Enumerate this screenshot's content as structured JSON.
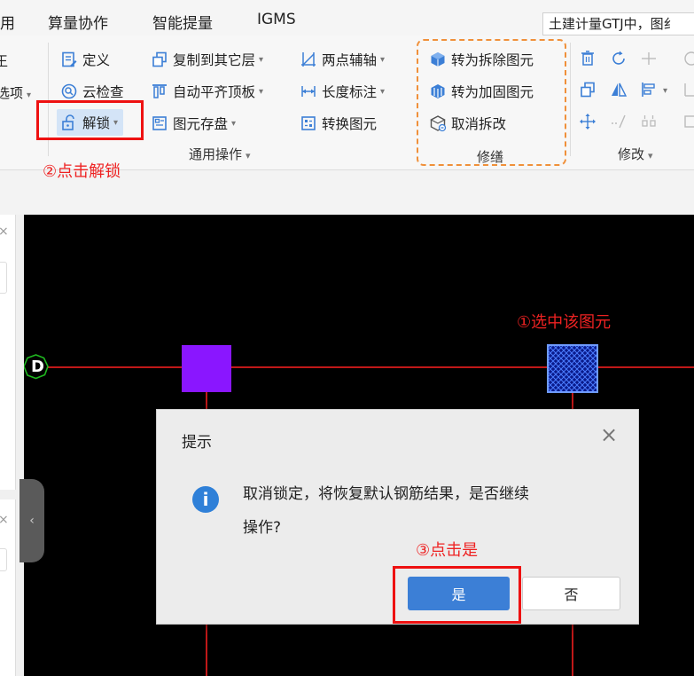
{
  "menubar": {
    "items": [
      "用",
      "算量协作",
      "智能提量",
      "IGMS"
    ],
    "project_title": "土建计量GTJ中，图纟"
  },
  "ribbon": {
    "left_cut": [
      "王",
      "选项"
    ],
    "common_ops": {
      "define": "定义",
      "cloud_check": "云检查",
      "unlock": "解锁",
      "copy_to_layer": "复制到其它层",
      "auto_align_slab": "自动平齐顶板",
      "element_save": "图元存盘",
      "two_point_axis": "两点辅轴",
      "length_dim": "长度标注",
      "convert_element": "转换图元",
      "group_label": "通用操作"
    },
    "repair": {
      "to_demolish": "转为拆除图元",
      "to_reinforce": "转为加固图元",
      "cancel_demolish": "取消拆改",
      "group_label": "修缮"
    },
    "modify": {
      "group_label": "修改"
    }
  },
  "annotations": {
    "step1": "①选中该图元",
    "step2": "②点击解锁",
    "step3": "③点击是"
  },
  "canvas": {
    "axis_label": "D"
  },
  "colors": {
    "accent": "#3c7fd6",
    "highlight": "#ee1111",
    "axis": "#ff2020",
    "purple_element": "#8a16ff",
    "selected_element": "#1f3fd6"
  },
  "dialog": {
    "title": "提示",
    "message_line1": "取消锁定，将恢复默认钢筋结果，是否继续",
    "message_line2": "操作?",
    "yes": "是",
    "no": "否"
  }
}
